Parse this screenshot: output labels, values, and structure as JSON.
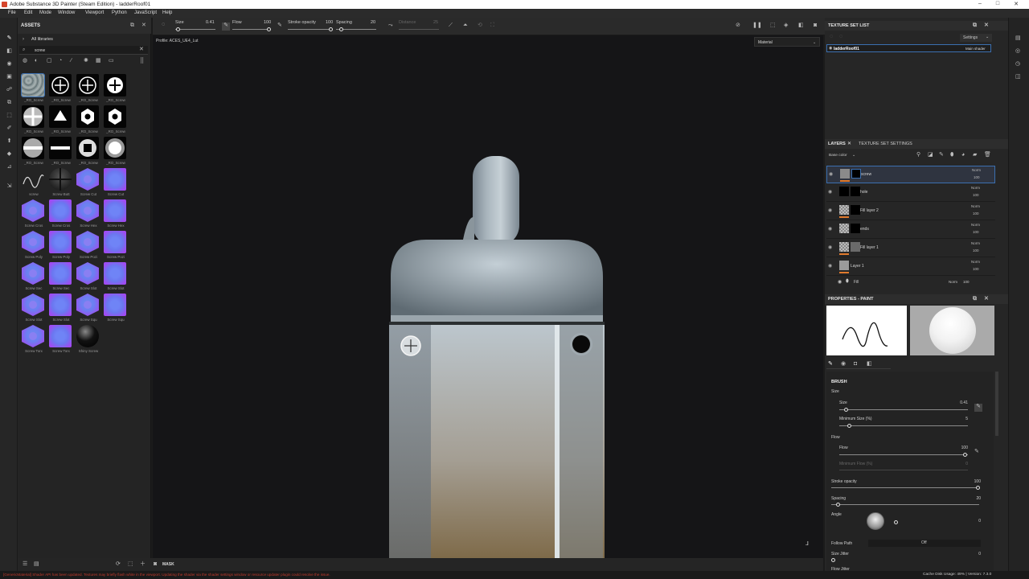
{
  "window": {
    "title": "Adobe Substance 3D Painter (Steam Edition) - ladderRoof01",
    "min": "–",
    "max": "□",
    "close": "✕"
  },
  "menu": [
    "File",
    "Edit",
    "Mode",
    "Window",
    "Viewport",
    "Python",
    "JavaScript",
    "Help"
  ],
  "toolbar": {
    "size_label": "Size",
    "size_value": "0.41",
    "flow_label": "Flow",
    "flow_value": "100",
    "stroke_label": "Stroke opacity",
    "stroke_value": "100",
    "spacing_label": "Spacing",
    "spacing_value": "20",
    "distance_label": "Distance",
    "distance_value": "25"
  },
  "assets": {
    "title": "ASSETS",
    "library": "All libraries",
    "search_value": "screw",
    "tiles": [
      {
        "caption": "_RO_Screw",
        "kind": "texture"
      },
      {
        "caption": "_RO_Screw",
        "kind": "plus"
      },
      {
        "caption": "_RO_Screw",
        "kind": "plus"
      },
      {
        "caption": "_RO_Screw",
        "kind": "plus-solid"
      },
      {
        "caption": "_RO_Screw",
        "kind": "plus-soft"
      },
      {
        "caption": "_RO_Screw",
        "kind": "triangle"
      },
      {
        "caption": "_RO_Screw",
        "kind": "hexnut"
      },
      {
        "caption": "_RO_Screw",
        "kind": "hexnut"
      },
      {
        "caption": "_RO_Screw",
        "kind": "slot-soft"
      },
      {
        "caption": "_RO_Screw",
        "kind": "bar"
      },
      {
        "caption": "_RO_Screw",
        "kind": "square"
      },
      {
        "caption": "_RO_Screw",
        "kind": "ring"
      },
      {
        "caption": "screw",
        "kind": "wave"
      },
      {
        "caption": "Screw Butt",
        "kind": "sphere-dark"
      },
      {
        "caption": "Screw Cut",
        "kind": "hex"
      },
      {
        "caption": "Screw Cut",
        "kind": "circ"
      },
      {
        "caption": "Screw Cros",
        "kind": "hex"
      },
      {
        "caption": "Screw Cros",
        "kind": "circ"
      },
      {
        "caption": "Screw Hex",
        "kind": "hex"
      },
      {
        "caption": "Screw Hex",
        "kind": "circ"
      },
      {
        "caption": "Screw Poly",
        "kind": "hex"
      },
      {
        "caption": "Screw Poly",
        "kind": "circ"
      },
      {
        "caption": "Screw Pozi",
        "kind": "hex"
      },
      {
        "caption": "Screw Pozi",
        "kind": "circ"
      },
      {
        "caption": "Screw Sec",
        "kind": "hex"
      },
      {
        "caption": "Screw Sec",
        "kind": "circ"
      },
      {
        "caption": "Screw Slot",
        "kind": "hex"
      },
      {
        "caption": "Screw Slot",
        "kind": "circ"
      },
      {
        "caption": "Screw Slot",
        "kind": "hex"
      },
      {
        "caption": "Screw Slot",
        "kind": "circ"
      },
      {
        "caption": "Screw Squ",
        "kind": "hex"
      },
      {
        "caption": "Screw Squ",
        "kind": "circ"
      },
      {
        "caption": "Screw Torx",
        "kind": "hex"
      },
      {
        "caption": "Screw Torx",
        "kind": "circ"
      },
      {
        "caption": "Shiny Screw",
        "kind": "sphere-black"
      }
    ]
  },
  "viewport": {
    "profile": "Profile: ACES_UE4_Lut",
    "mode": "Material",
    "mask_label": "MASK"
  },
  "texture_set_list": {
    "title": "TEXTURE SET LIST",
    "settings": "Settings",
    "item": "ladderRoof01",
    "shader": "Main shader"
  },
  "layers": {
    "tab_layers": "LAYERS",
    "tab_tss": "TEXTURE SET SETTINGS",
    "channel": "Base color",
    "items": [
      {
        "name": "screw",
        "blend": "Norm",
        "opacity": "100"
      },
      {
        "name": "hole",
        "blend": "Norm",
        "opacity": "100"
      },
      {
        "name": "Fill layer 2",
        "blend": "Norm",
        "opacity": "100"
      },
      {
        "name": "ends",
        "blend": "Norm",
        "opacity": "100"
      },
      {
        "name": "Fill layer 1",
        "blend": "Norm",
        "opacity": "100"
      },
      {
        "name": "Layer 1",
        "blend": "Norm",
        "opacity": "100"
      }
    ],
    "sub_fill": {
      "name": "Fill",
      "blend": "Norm",
      "opacity": "100"
    }
  },
  "properties": {
    "title": "PROPERTIES - PAINT",
    "brush_section": "BRUSH",
    "size_group": "Size",
    "size_label": "Size",
    "size_value": "0.41",
    "minsize_label": "Minimum Size (%)",
    "minsize_value": "5",
    "flow_group": "Flow",
    "flow_label": "Flow",
    "flow_value": "100",
    "minflow_label": "Minimum Flow (%)",
    "minflow_value": "0",
    "stroke_label": "Stroke opacity",
    "stroke_value": "100",
    "spacing_label": "Spacing",
    "spacing_value": "20",
    "angle_label": "Angle",
    "angle_value": "0",
    "follow_label": "Follow Path",
    "follow_value": "Off",
    "sizejitter_label": "Size Jitter",
    "sizejitter_value": "0",
    "flowjitter_label": "Flow Jitter"
  },
  "status": {
    "message": "[GenericMaterial] Shader API has been updated. Textures may briefly flash white in the viewport. Updating the shader via the shader settings window or resource updater plugin could resolve the issue.",
    "disk": "Cache Disk Usage:  49% | Version: 7.3.0"
  },
  "colors": {
    "accent": "#e07a2d",
    "selection": "#3b6fb0",
    "error_text": "#c0392b"
  }
}
